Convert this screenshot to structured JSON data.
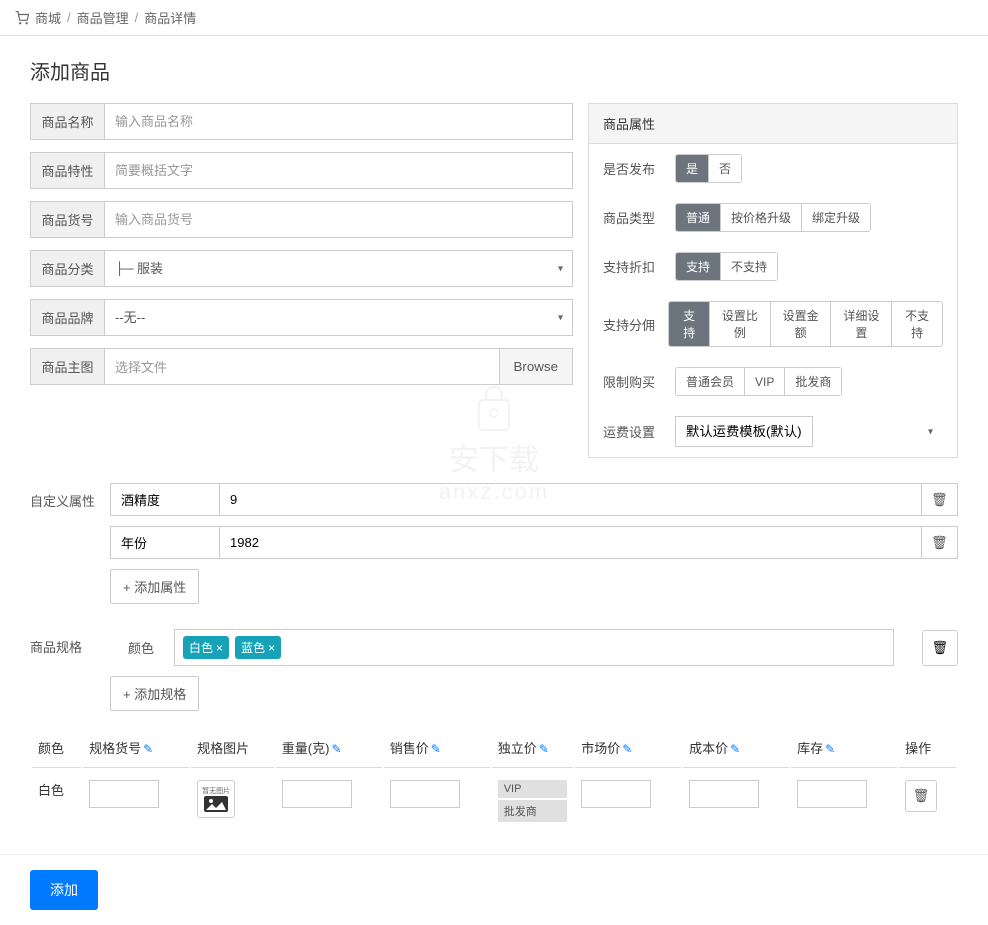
{
  "breadcrumb": {
    "root": "商城",
    "mid": "商品管理",
    "leaf": "商品详情"
  },
  "title": "添加商品",
  "form": {
    "name_label": "商品名称",
    "name_placeholder": "输入商品名称",
    "feature_label": "商品特性",
    "feature_placeholder": "简要概括文字",
    "sku_label": "商品货号",
    "sku_placeholder": "输入商品货号",
    "category_label": "商品分类",
    "category_value": "├─ 服装",
    "brand_label": "商品品牌",
    "brand_value": "--无--",
    "image_label": "商品主图",
    "image_text": "选择文件",
    "browse": "Browse"
  },
  "attrs": {
    "header": "商品属性",
    "publish_label": "是否发布",
    "publish_opts": [
      "是",
      "否"
    ],
    "type_label": "商品类型",
    "type_opts": [
      "普通",
      "按价格升级",
      "绑定升级"
    ],
    "discount_label": "支持折扣",
    "discount_opts": [
      "支持",
      "不支持"
    ],
    "commission_label": "支持分佣",
    "commission_opts": [
      "支持",
      "设置比例",
      "设置金额",
      "详细设置",
      "不支持"
    ],
    "limit_label": "限制购买",
    "limit_opts": [
      "普通会员",
      "VIP",
      "批发商"
    ],
    "shipping_label": "运费设置",
    "shipping_value": "默认运费模板(默认)"
  },
  "custom": {
    "label": "自定义属性",
    "rows": [
      {
        "key": "酒精度",
        "val": "9"
      },
      {
        "key": "年份",
        "val": "1982"
      }
    ],
    "add": "+ 添加属性"
  },
  "spec": {
    "label": "商品规格",
    "name": "颜色",
    "tags": [
      "白色",
      "蓝色"
    ],
    "add": "+ 添加规格"
  },
  "table": {
    "cols": [
      "颜色",
      "规格货号",
      "规格图片",
      "重量(克)",
      "销售价",
      "独立价",
      "市场价",
      "成本价",
      "库存",
      "操作"
    ],
    "row_color": "白色",
    "vip_tags": [
      "VIP",
      "批发商"
    ],
    "img_text": "暂无图片"
  },
  "submit": "添加",
  "watermark": "安下载\nanxz.com"
}
